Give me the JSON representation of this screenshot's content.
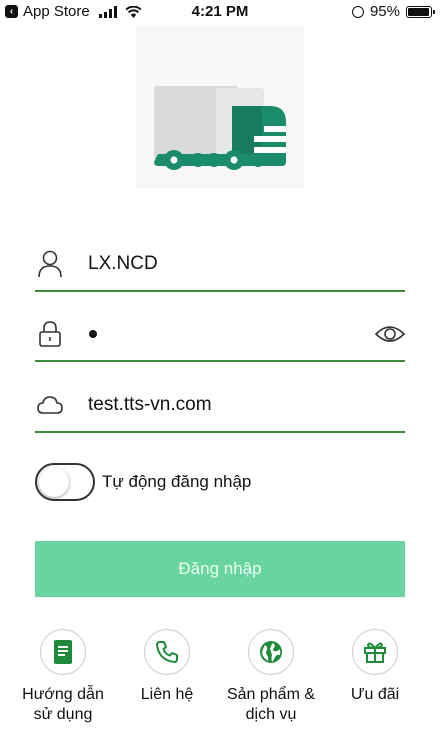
{
  "status_bar": {
    "back_app": "App Store",
    "time": "4:21 PM",
    "battery": "95%",
    "battery_level": 0.95
  },
  "login": {
    "username": "LX.NCD",
    "password_masked": "•",
    "server": "test.tts-vn.com",
    "auto_login_label": "Tự động đăng nhập",
    "auto_login_enabled": false,
    "login_button": "Đăng nhập"
  },
  "bottom_menu": [
    {
      "label_line1": "Hướng dẫn",
      "label_line2": "sử dụng",
      "icon": "document-icon"
    },
    {
      "label_line1": "Liên hệ",
      "label_line2": "",
      "icon": "phone-icon"
    },
    {
      "label_line1": "Sản phẩm &",
      "label_line2": "dịch vụ",
      "icon": "globe-icon"
    },
    {
      "label_line1": "Ưu đãi",
      "label_line2": "",
      "icon": "gift-icon"
    }
  ],
  "colors": {
    "accent": "#3a8b3a",
    "button": "#6ad4a0",
    "icon_green": "#1e8a3a",
    "truck_teal": "#1a8c6a",
    "truck_gray": "#d7dad9"
  }
}
